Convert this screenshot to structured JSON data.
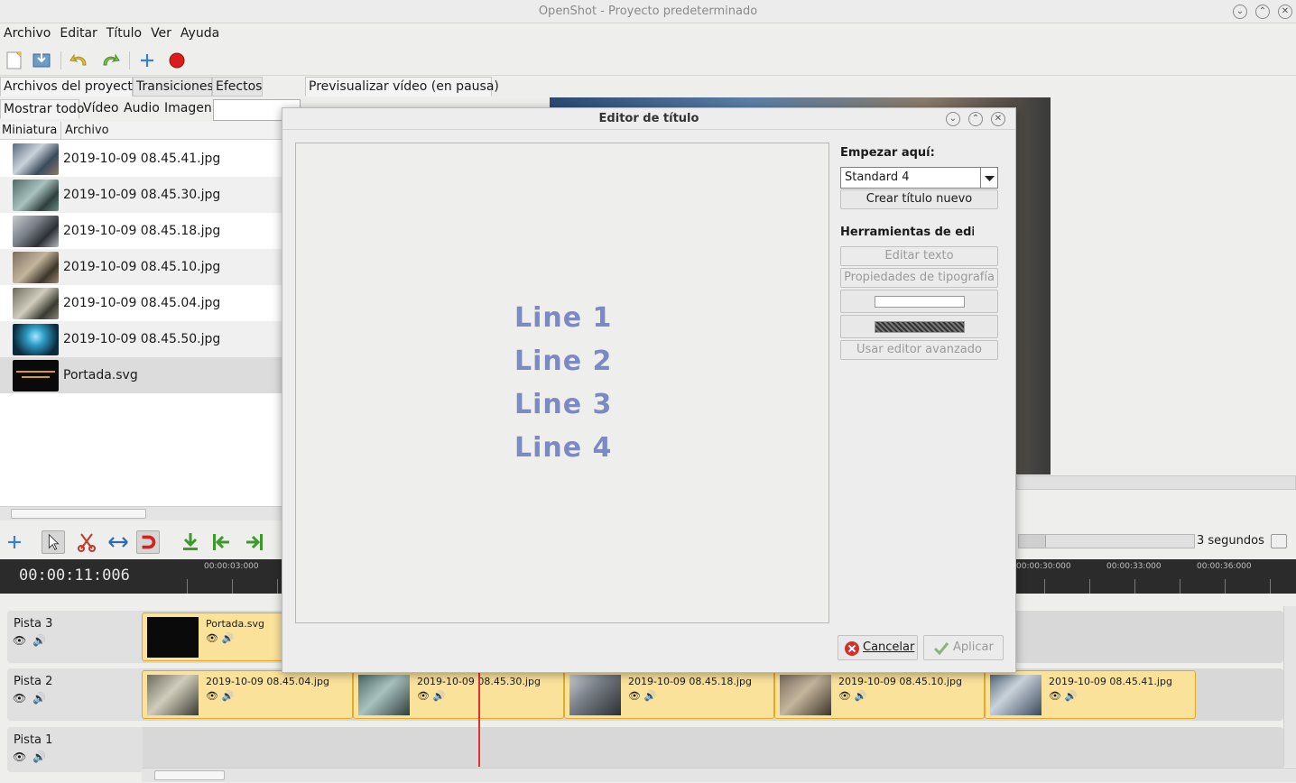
{
  "window": {
    "title": "OpenShot - Proyecto predeterminado"
  },
  "menu": [
    "Archivo",
    "Editar",
    "Título",
    "Ver",
    "Ayuda"
  ],
  "left_tabs": [
    "Archivos del proyecto",
    "Transiciones",
    "Efectos"
  ],
  "filters": [
    "Mostrar todo",
    "Vídeo",
    "Audio",
    "Imagen"
  ],
  "columns": [
    "Miniatura",
    "Archivo"
  ],
  "files": [
    "2019-10-09 08.45.41.jpg",
    "2019-10-09 08.45.30.jpg",
    "2019-10-09 08.45.18.jpg",
    "2019-10-09 08.45.10.jpg",
    "2019-10-09 08.45.04.jpg",
    "2019-10-09 08.45.50.jpg",
    "Portada.svg"
  ],
  "preview_tab": "Previsualizar vídeo (en pausa)",
  "timeline": {
    "timecode": "00:00:11:006",
    "ticks": [
      "00:00:03:000",
      "00:00:30:000",
      "00:00:33:000",
      "00:00:36:000"
    ],
    "zoom_label": "3 segundos",
    "tracks": [
      "Pista 3",
      "Pista 2",
      "Pista 1"
    ],
    "clips_track3": [
      "Portada.svg"
    ],
    "clips_track2": [
      "2019-10-09 08.45.04.jpg",
      "2019-10-09 08.45.30.jpg",
      "2019-10-09 08.45.18.jpg",
      "2019-10-09 08.45.10.jpg",
      "2019-10-09 08.45.41.jpg"
    ]
  },
  "dialog": {
    "title": "Editor de título",
    "lines": [
      "Line 1",
      "Line 2",
      "Line 3",
      "Line 4"
    ],
    "start_label": "Empezar aquí:",
    "template_value": "Standard 4",
    "create_button": "Crear título nuevo",
    "tools_label": "Herramientas de edición",
    "edit_text": "Editar texto",
    "font_props": "Propiedades de tipografía",
    "advanced": "Usar editor avanzado",
    "cancel": "Cancelar",
    "apply": "Aplicar"
  }
}
